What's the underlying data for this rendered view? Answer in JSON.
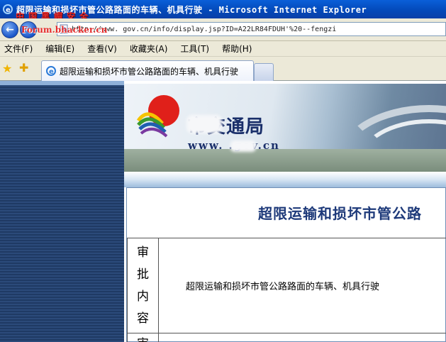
{
  "window": {
    "title": "超限运输和损坏市管公路路面的车辆、机具行驶 - Microsoft Internet Explorer",
    "watermark_cn": "中国黑帽安全",
    "watermark_en": "Forum.bhacker.cn"
  },
  "address": {
    "url": "http://www.    gov.cn/info/display.jsp?ID=A22LR84FDUH'%20--fengzi"
  },
  "menu": {
    "items": [
      "文件(F)",
      "编辑(E)",
      "查看(V)",
      "收藏夹(A)",
      "工具(T)",
      "帮助(H)"
    ]
  },
  "tabs": [
    {
      "label": "超限运输和损坏市管公路路面的车辆、机具行驶"
    }
  ],
  "banner": {
    "bureau_name": "  市交通局",
    "bureau_url": "www.    .gov.cn"
  },
  "content": {
    "page_title": "超限运输和损坏市管公路",
    "rows": [
      {
        "label": "审批内容",
        "value": "超限运输和损坏市管公路路面的车辆、机具行驶"
      },
      {
        "label": "审",
        "value": ""
      }
    ]
  },
  "colors": {
    "titlebar": "#0348b8",
    "title_text": "#1e3a7a",
    "sidebar": "#1f3a64",
    "watermark": "#e52c2c"
  }
}
